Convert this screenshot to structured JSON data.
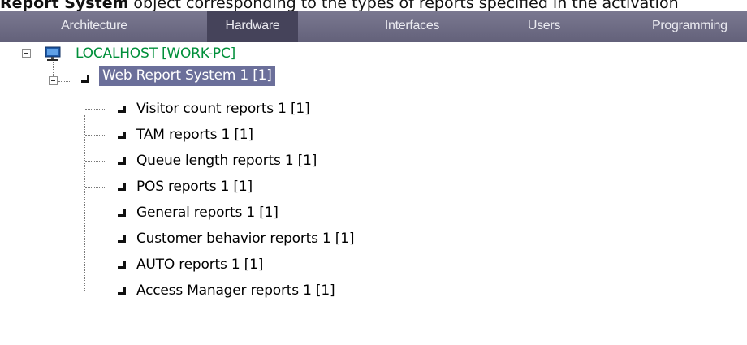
{
  "caption": {
    "bold": "Report System",
    "rest": " object corresponding to the types of reports specified in the activation"
  },
  "tabs": [
    {
      "label": "Architecture",
      "active": false
    },
    {
      "label": "Hardware",
      "active": true
    },
    {
      "label": "Interfaces",
      "active": false
    },
    {
      "label": "Users",
      "active": false
    },
    {
      "label": "Programming",
      "active": false
    }
  ],
  "tree": {
    "root": {
      "label": "LOCALHOST [WORK-PC]",
      "icon": "computer-icon"
    },
    "parent": {
      "label": "Web Report System 1 [1]",
      "selected": true
    },
    "children": [
      {
        "label": "Visitor count reports 1 [1]"
      },
      {
        "label": "TAM reports 1 [1]"
      },
      {
        "label": "Queue length reports 1 [1]"
      },
      {
        "label": "POS reports 1 [1]"
      },
      {
        "label": "General reports 1 [1]"
      },
      {
        "label": "Customer behavior reports 1 [1]"
      },
      {
        "label": "AUTO reports 1 [1]"
      },
      {
        "label": "Access Manager reports 1 [1]"
      }
    ]
  },
  "colors": {
    "tabbar": "#6e6c84",
    "active_tab": "#45435a",
    "root_text": "#008f3a",
    "selection": "#6b6f9a"
  }
}
